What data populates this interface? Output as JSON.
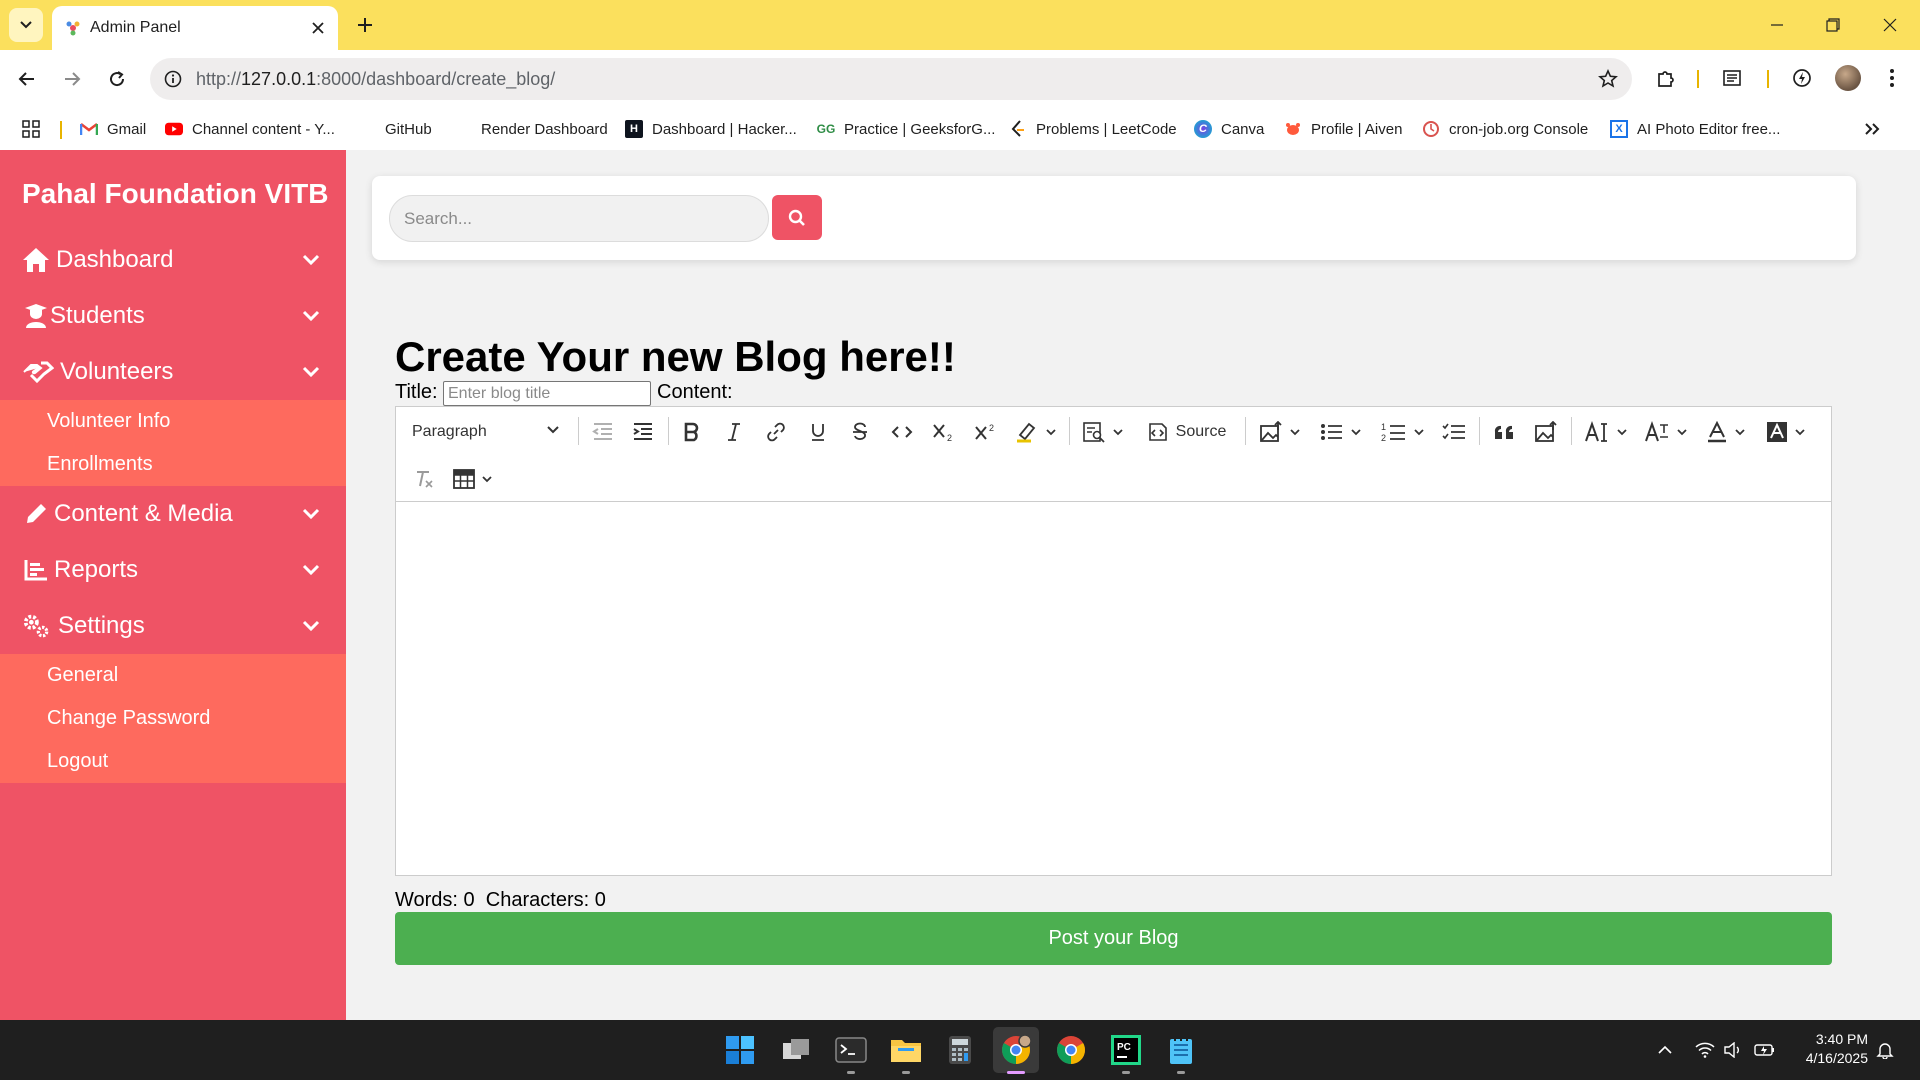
{
  "browser": {
    "tab_title": "Admin Panel",
    "url_prefix": "http://",
    "url_host": "127.0.0.1",
    "url_rest": ":8000/dashboard/create_blog/",
    "bookmarks": [
      {
        "label": "Gmail",
        "icon": "gmail-icon"
      },
      {
        "label": "Channel content - Y...",
        "icon": "youtube-icon"
      },
      {
        "label": "GitHub",
        "icon": "github-icon"
      },
      {
        "label": "Render Dashboard",
        "icon": "render-icon"
      },
      {
        "label": "Dashboard | Hacker...",
        "icon": "hackerrank-icon"
      },
      {
        "label": "Practice | GeeksforG...",
        "icon": "geeksforgeeks-icon"
      },
      {
        "label": "Problems | LeetCode",
        "icon": "leetcode-icon"
      },
      {
        "label": "Canva",
        "icon": "canva-icon"
      },
      {
        "label": "Profile | Aiven",
        "icon": "aiven-icon"
      },
      {
        "label": "cron-job.org Console",
        "icon": "cronjob-icon"
      },
      {
        "label": "AI Photo Editor free...",
        "icon": "photo-editor-icon"
      }
    ]
  },
  "sidebar": {
    "brand": "Pahal Foundation VITB",
    "items": [
      {
        "label": "Dashboard",
        "icon": "home-icon"
      },
      {
        "label": "Students",
        "icon": "student-icon"
      },
      {
        "label": "Volunteers",
        "icon": "handshake-icon"
      },
      {
        "label": "Content & Media",
        "icon": "pencil-icon"
      },
      {
        "label": "Reports",
        "icon": "chart-icon"
      },
      {
        "label": "Settings",
        "icon": "gears-icon"
      }
    ],
    "volunteers_sub": [
      "Volunteer Info",
      "Enrollments"
    ],
    "settings_sub": [
      "General",
      "Change Password",
      "Logout"
    ],
    "colors": {
      "sidebar": "#ef5365",
      "submenu": "#fe6a5e"
    }
  },
  "search": {
    "placeholder": "Search...",
    "button_color": "#ef5365"
  },
  "main": {
    "heading": "Create Your new Blog here!!",
    "title_label": "Title:",
    "title_placeholder": "Enter blog title",
    "content_label": "Content:",
    "editor": {
      "block_format": "Paragraph",
      "source_label": "Source"
    },
    "word_count": "Words: 0",
    "char_count": "Characters: 0",
    "post_button": "Post your Blog",
    "post_button_color": "#4caf50"
  },
  "taskbar": {
    "time": "3:40 PM",
    "date": "4/16/2025"
  }
}
